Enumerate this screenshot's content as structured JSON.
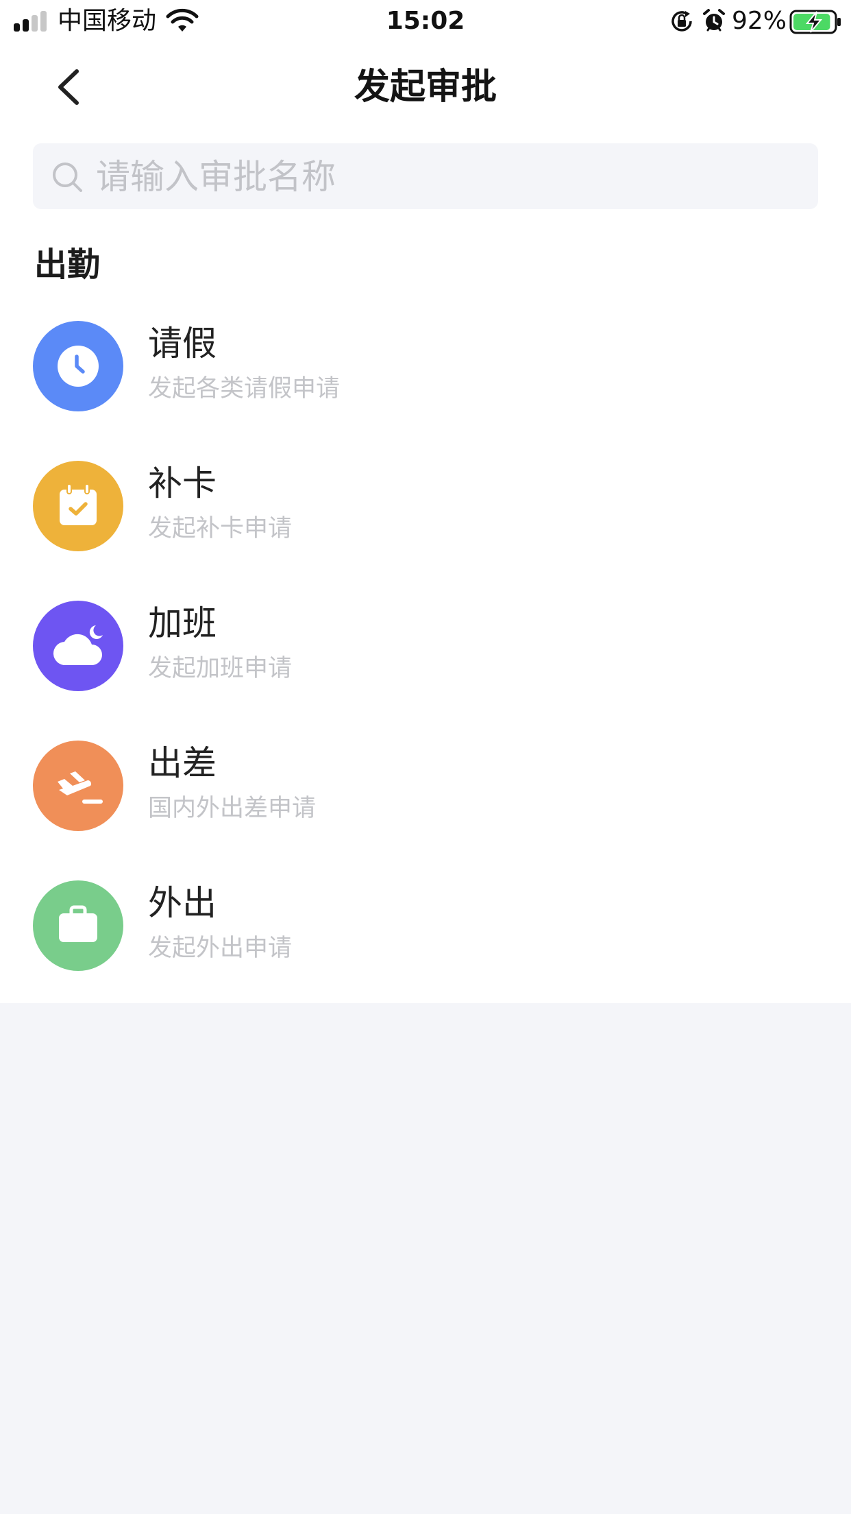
{
  "status_bar": {
    "carrier": "中国移动",
    "time": "15:02",
    "battery_percent": "92%",
    "battery_level": 0.92
  },
  "nav": {
    "title": "发起审批"
  },
  "search": {
    "placeholder": "请输入审批名称"
  },
  "section": {
    "title": "出勤",
    "items": [
      {
        "title": "请假",
        "desc": "发起各类请假申请",
        "icon": "clock-icon",
        "color": "#5b8af7"
      },
      {
        "title": "补卡",
        "desc": "发起补卡申请",
        "icon": "calendar-check-icon",
        "color": "#eeb23a"
      },
      {
        "title": "加班",
        "desc": "发起加班申请",
        "icon": "cloud-moon-icon",
        "color": "#6e55f2"
      },
      {
        "title": "出差",
        "desc": "国内外出差申请",
        "icon": "plane-icon",
        "color": "#f08f58"
      },
      {
        "title": "外出",
        "desc": "发起外出申请",
        "icon": "briefcase-icon",
        "color": "#79cd8b"
      }
    ]
  }
}
